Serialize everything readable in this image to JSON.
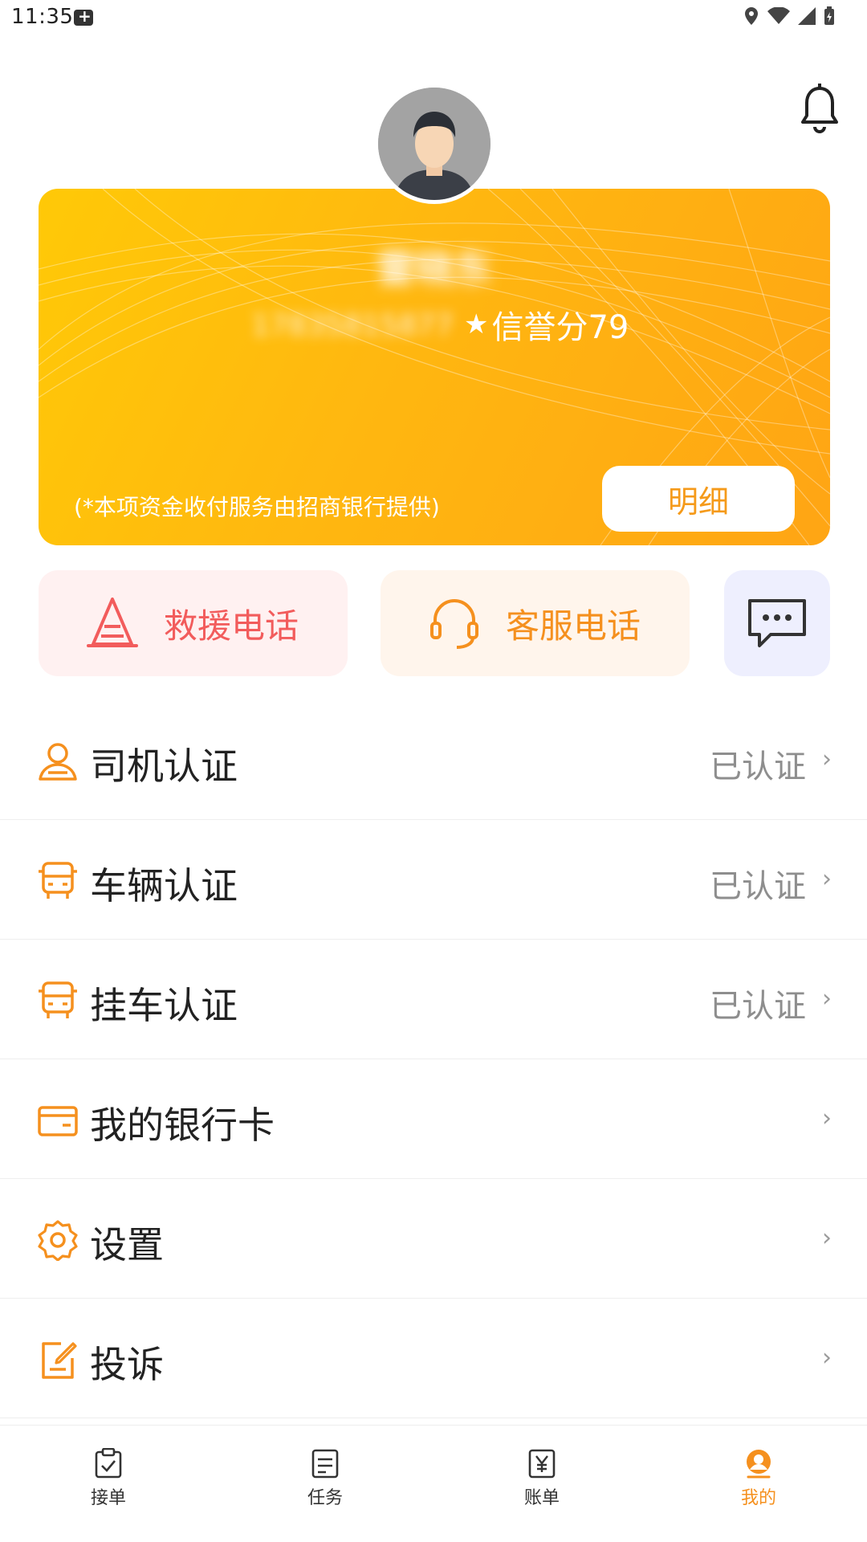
{
  "status_bar": {
    "time": "11:35"
  },
  "profile": {
    "name": "雷晓东",
    "phone": "17835815877",
    "credit_label": "信誉分79",
    "note": "(*本项资金收付服务由招商银行提供)",
    "detail_button": "明细"
  },
  "quick_actions": {
    "rescue_label": "救援电话",
    "service_label": "客服电话"
  },
  "menu": [
    {
      "label": "司机认证",
      "status": "已认证",
      "icon": "driver-icon"
    },
    {
      "label": "车辆认证",
      "status": "已认证",
      "icon": "vehicle-icon"
    },
    {
      "label": "挂车认证",
      "status": "已认证",
      "icon": "trailer-icon"
    },
    {
      "label": "我的银行卡",
      "status": "",
      "icon": "bank-card-icon"
    },
    {
      "label": "设置",
      "status": "",
      "icon": "settings-icon"
    },
    {
      "label": "投诉",
      "status": "",
      "icon": "complaint-icon"
    }
  ],
  "chevron": "›",
  "bottom_nav": [
    {
      "label": "接单",
      "icon": "clipboard-check-icon"
    },
    {
      "label": "任务",
      "icon": "task-list-icon"
    },
    {
      "label": "账单",
      "icon": "bill-yuan-icon"
    },
    {
      "label": "我的",
      "icon": "profile-icon",
      "active": true
    }
  ],
  "colors": {
    "accent": "#f5901e",
    "card_start": "#ffc907",
    "card_end": "#ffa514",
    "rescue": "#f25c5c"
  }
}
